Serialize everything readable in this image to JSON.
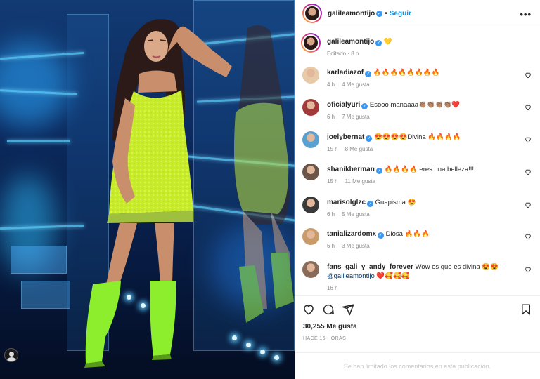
{
  "post": {
    "username": "galileamontijo",
    "follow_label": "Seguir",
    "dot": "•",
    "caption_emoji": "💛",
    "edited_label": "Editado · 8 h"
  },
  "comments": [
    {
      "username": "karladiazof",
      "verified": true,
      "text": "🔥🔥🔥🔥🔥🔥🔥🔥",
      "time": "4 h",
      "likes": "4 Me gusta",
      "avatar_color": "#e8c9a8"
    },
    {
      "username": "oficialyuri",
      "verified": true,
      "text": "Esooo manaaaa👏🏽👏🏽👏🏽👏🏽❤️",
      "time": "6 h",
      "likes": "7 Me gusta",
      "avatar_color": "#a33a3a"
    },
    {
      "username": "joelybernat",
      "verified": true,
      "text": "😍😍😍😍Divina 🔥🔥🔥🔥",
      "time": "15 h",
      "likes": "8 Me gusta",
      "avatar_color": "#5aa0d0"
    },
    {
      "username": "shanikberman",
      "verified": true,
      "text": "🔥🔥🔥🔥 eres una belleza!!!",
      "time": "15 h",
      "likes": "11 Me gusta",
      "avatar_color": "#6b5548"
    },
    {
      "username": "marisolglzc",
      "verified": true,
      "text": "Guapisma 😍",
      "time": "6 h",
      "likes": "5 Me gusta",
      "avatar_color": "#3a3a3a"
    },
    {
      "username": "tanializardomx",
      "verified": true,
      "text": "Diosa 🔥🔥🔥",
      "time": "6 h",
      "likes": "3 Me gusta",
      "avatar_color": "#c99a6a"
    },
    {
      "username": "fans_gali_y_andy_forever",
      "verified": false,
      "text": "Wow es que es divina 😍😍",
      "mention": "@galileamontijo",
      "text2": "❤️🥰🥰🥰",
      "time": "16 h",
      "likes": "",
      "avatar_color": "#8a6b5a"
    }
  ],
  "stats": {
    "likes": "30,255 Me gusta",
    "timestamp": "HACE 16 HORAS"
  },
  "limited_comments": "Se han limitado los comentarios en esta publicación.",
  "icons": [
    "heart-icon",
    "comment-icon",
    "share-icon",
    "bookmark-icon",
    "more-icon",
    "verified-icon"
  ]
}
